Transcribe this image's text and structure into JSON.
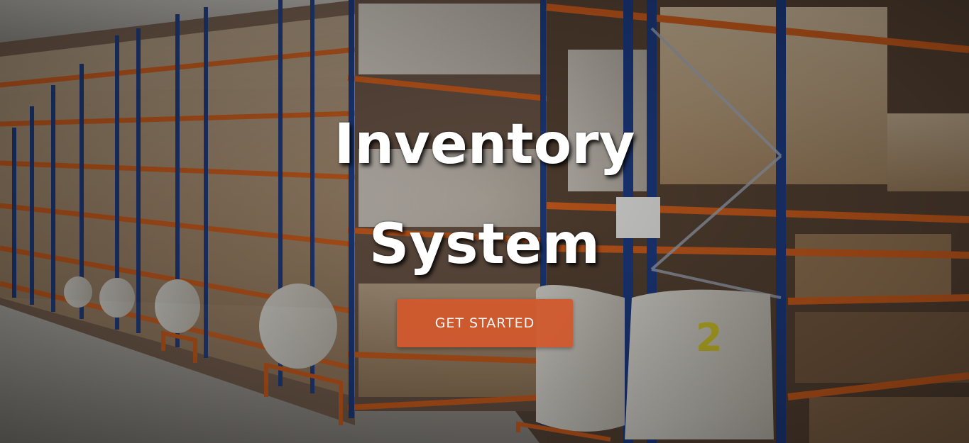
{
  "hero": {
    "title_line1": "Inventory",
    "title_line2": "System",
    "cta_label": "GET STARTED",
    "background": "warehouse-racks-photo"
  },
  "colors": {
    "cta_background": "#d2592d",
    "title_text": "#ffffff",
    "rack_orange": "#d8621e",
    "rack_blue": "#1f3f8a"
  },
  "bag_labels": [
    "2"
  ]
}
